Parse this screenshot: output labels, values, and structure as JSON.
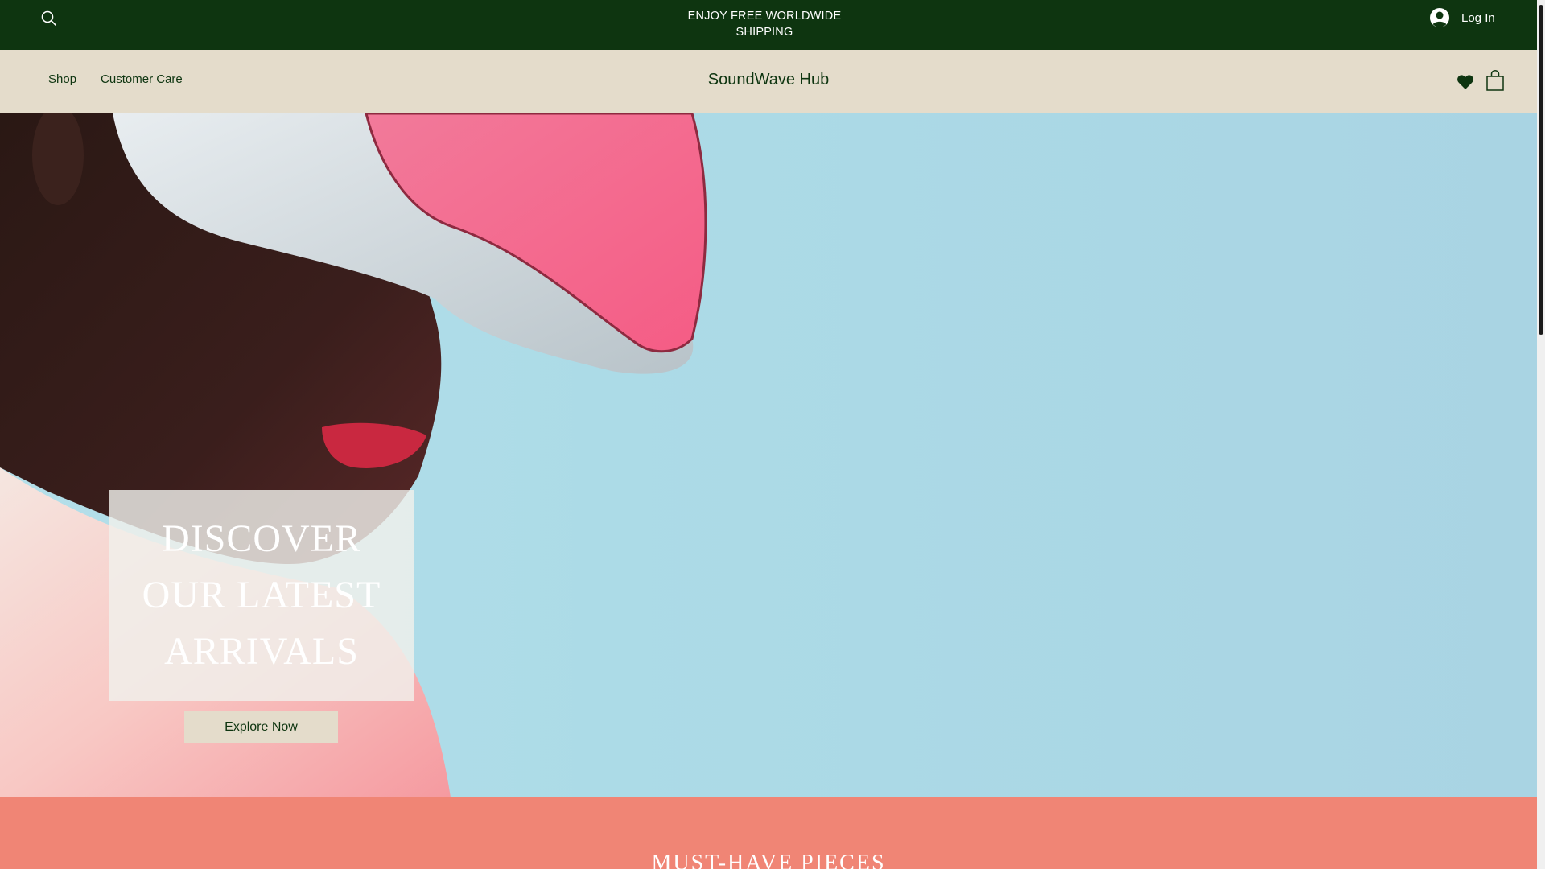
{
  "topbar": {
    "announcement": "ENJOY FREE WORLDWIDE SHIPPING",
    "login_label": "Log In",
    "search_icon": "search-icon",
    "avatar_icon": "user-avatar-icon",
    "background": "#0e3510"
  },
  "header": {
    "brand": "SoundWave Hub",
    "nav": [
      {
        "label": "Shop"
      },
      {
        "label": "Customer Care"
      }
    ],
    "wishlist_icon": "heart-icon",
    "cart_icon": "shopping-bag-icon",
    "background": "#e4dccb"
  },
  "hero": {
    "headline": "DISCOVER OUR LATEST ARRIVALS",
    "cta_label": "Explore Now",
    "background": "#acdbe7"
  },
  "section": {
    "title": "MUST-HAVE PIECES",
    "background": "#f08575"
  }
}
